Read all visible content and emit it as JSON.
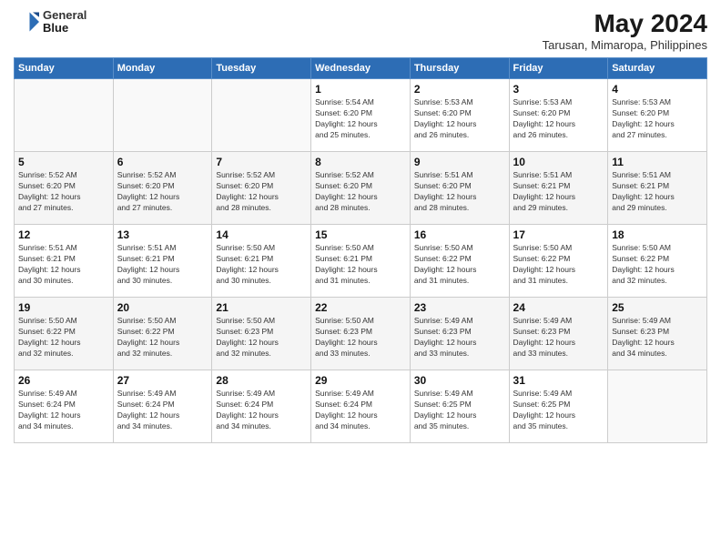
{
  "logo": {
    "line1": "General",
    "line2": "Blue"
  },
  "title": "May 2024",
  "subtitle": "Tarusan, Mimaropa, Philippines",
  "days_of_week": [
    "Sunday",
    "Monday",
    "Tuesday",
    "Wednesday",
    "Thursday",
    "Friday",
    "Saturday"
  ],
  "weeks": [
    [
      {
        "day": "",
        "info": ""
      },
      {
        "day": "",
        "info": ""
      },
      {
        "day": "",
        "info": ""
      },
      {
        "day": "1",
        "info": "Sunrise: 5:54 AM\nSunset: 6:20 PM\nDaylight: 12 hours\nand 25 minutes."
      },
      {
        "day": "2",
        "info": "Sunrise: 5:53 AM\nSunset: 6:20 PM\nDaylight: 12 hours\nand 26 minutes."
      },
      {
        "day": "3",
        "info": "Sunrise: 5:53 AM\nSunset: 6:20 PM\nDaylight: 12 hours\nand 26 minutes."
      },
      {
        "day": "4",
        "info": "Sunrise: 5:53 AM\nSunset: 6:20 PM\nDaylight: 12 hours\nand 27 minutes."
      }
    ],
    [
      {
        "day": "5",
        "info": "Sunrise: 5:52 AM\nSunset: 6:20 PM\nDaylight: 12 hours\nand 27 minutes."
      },
      {
        "day": "6",
        "info": "Sunrise: 5:52 AM\nSunset: 6:20 PM\nDaylight: 12 hours\nand 27 minutes."
      },
      {
        "day": "7",
        "info": "Sunrise: 5:52 AM\nSunset: 6:20 PM\nDaylight: 12 hours\nand 28 minutes."
      },
      {
        "day": "8",
        "info": "Sunrise: 5:52 AM\nSunset: 6:20 PM\nDaylight: 12 hours\nand 28 minutes."
      },
      {
        "day": "9",
        "info": "Sunrise: 5:51 AM\nSunset: 6:20 PM\nDaylight: 12 hours\nand 28 minutes."
      },
      {
        "day": "10",
        "info": "Sunrise: 5:51 AM\nSunset: 6:21 PM\nDaylight: 12 hours\nand 29 minutes."
      },
      {
        "day": "11",
        "info": "Sunrise: 5:51 AM\nSunset: 6:21 PM\nDaylight: 12 hours\nand 29 minutes."
      }
    ],
    [
      {
        "day": "12",
        "info": "Sunrise: 5:51 AM\nSunset: 6:21 PM\nDaylight: 12 hours\nand 30 minutes."
      },
      {
        "day": "13",
        "info": "Sunrise: 5:51 AM\nSunset: 6:21 PM\nDaylight: 12 hours\nand 30 minutes."
      },
      {
        "day": "14",
        "info": "Sunrise: 5:50 AM\nSunset: 6:21 PM\nDaylight: 12 hours\nand 30 minutes."
      },
      {
        "day": "15",
        "info": "Sunrise: 5:50 AM\nSunset: 6:21 PM\nDaylight: 12 hours\nand 31 minutes."
      },
      {
        "day": "16",
        "info": "Sunrise: 5:50 AM\nSunset: 6:22 PM\nDaylight: 12 hours\nand 31 minutes."
      },
      {
        "day": "17",
        "info": "Sunrise: 5:50 AM\nSunset: 6:22 PM\nDaylight: 12 hours\nand 31 minutes."
      },
      {
        "day": "18",
        "info": "Sunrise: 5:50 AM\nSunset: 6:22 PM\nDaylight: 12 hours\nand 32 minutes."
      }
    ],
    [
      {
        "day": "19",
        "info": "Sunrise: 5:50 AM\nSunset: 6:22 PM\nDaylight: 12 hours\nand 32 minutes."
      },
      {
        "day": "20",
        "info": "Sunrise: 5:50 AM\nSunset: 6:22 PM\nDaylight: 12 hours\nand 32 minutes."
      },
      {
        "day": "21",
        "info": "Sunrise: 5:50 AM\nSunset: 6:23 PM\nDaylight: 12 hours\nand 32 minutes."
      },
      {
        "day": "22",
        "info": "Sunrise: 5:50 AM\nSunset: 6:23 PM\nDaylight: 12 hours\nand 33 minutes."
      },
      {
        "day": "23",
        "info": "Sunrise: 5:49 AM\nSunset: 6:23 PM\nDaylight: 12 hours\nand 33 minutes."
      },
      {
        "day": "24",
        "info": "Sunrise: 5:49 AM\nSunset: 6:23 PM\nDaylight: 12 hours\nand 33 minutes."
      },
      {
        "day": "25",
        "info": "Sunrise: 5:49 AM\nSunset: 6:23 PM\nDaylight: 12 hours\nand 34 minutes."
      }
    ],
    [
      {
        "day": "26",
        "info": "Sunrise: 5:49 AM\nSunset: 6:24 PM\nDaylight: 12 hours\nand 34 minutes."
      },
      {
        "day": "27",
        "info": "Sunrise: 5:49 AM\nSunset: 6:24 PM\nDaylight: 12 hours\nand 34 minutes."
      },
      {
        "day": "28",
        "info": "Sunrise: 5:49 AM\nSunset: 6:24 PM\nDaylight: 12 hours\nand 34 minutes."
      },
      {
        "day": "29",
        "info": "Sunrise: 5:49 AM\nSunset: 6:24 PM\nDaylight: 12 hours\nand 34 minutes."
      },
      {
        "day": "30",
        "info": "Sunrise: 5:49 AM\nSunset: 6:25 PM\nDaylight: 12 hours\nand 35 minutes."
      },
      {
        "day": "31",
        "info": "Sunrise: 5:49 AM\nSunset: 6:25 PM\nDaylight: 12 hours\nand 35 minutes."
      },
      {
        "day": "",
        "info": ""
      }
    ]
  ]
}
